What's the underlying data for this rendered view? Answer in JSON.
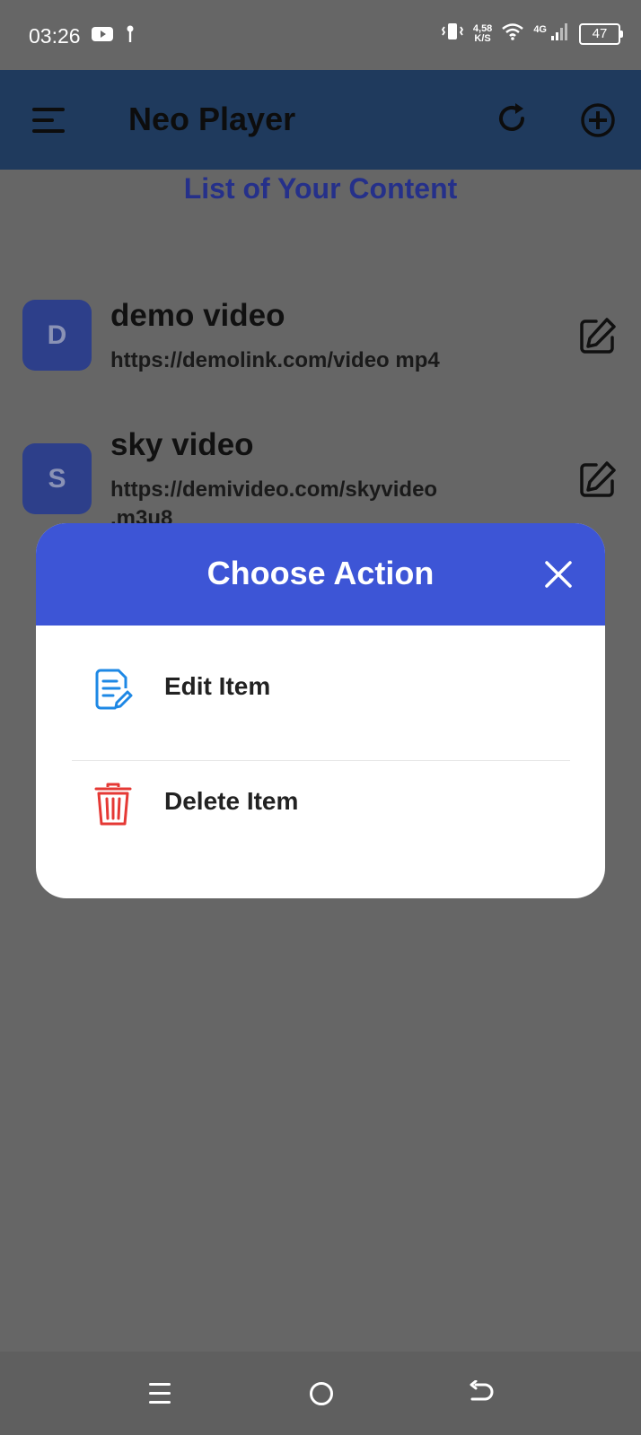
{
  "status_bar": {
    "time": "03:26",
    "net_speed_value": "4,58",
    "net_speed_unit": "K/S",
    "network_type": "4G",
    "battery": "47"
  },
  "app_bar": {
    "title": "Neo Player"
  },
  "section": {
    "title": "List of Your Content"
  },
  "items": [
    {
      "initial": "D",
      "name": "demo video",
      "url": "https://demolink.com/video mp4"
    },
    {
      "initial": "S",
      "name": "sky video",
      "url": "https://demivideo.com/skyvideo .m3u8"
    }
  ],
  "dialog": {
    "title": "Choose Action",
    "actions": [
      {
        "label": "Edit Item"
      },
      {
        "label": "Delete Item"
      }
    ]
  },
  "colors": {
    "app_bar": "#1f3a5d",
    "accent": "#3d55d6",
    "avatar": "#2d3f8a",
    "section_title": "#25308a",
    "delete": "#e53935",
    "edit": "#1e88e5",
    "overlay": "#666666"
  },
  "icons": {
    "status_left": [
      "youtube-icon",
      "notification-pin-icon"
    ],
    "status_right": [
      "vibrate-icon",
      "wifi-icon",
      "signal-icon",
      "battery-icon"
    ],
    "app_bar": [
      "menu-icon",
      "refresh-icon",
      "add-circle-icon"
    ],
    "item": [
      "edit-icon"
    ],
    "dialog": [
      "close-icon",
      "edit-document-icon",
      "trash-icon"
    ],
    "nav": [
      "recents-icon",
      "home-icon",
      "back-icon"
    ]
  }
}
